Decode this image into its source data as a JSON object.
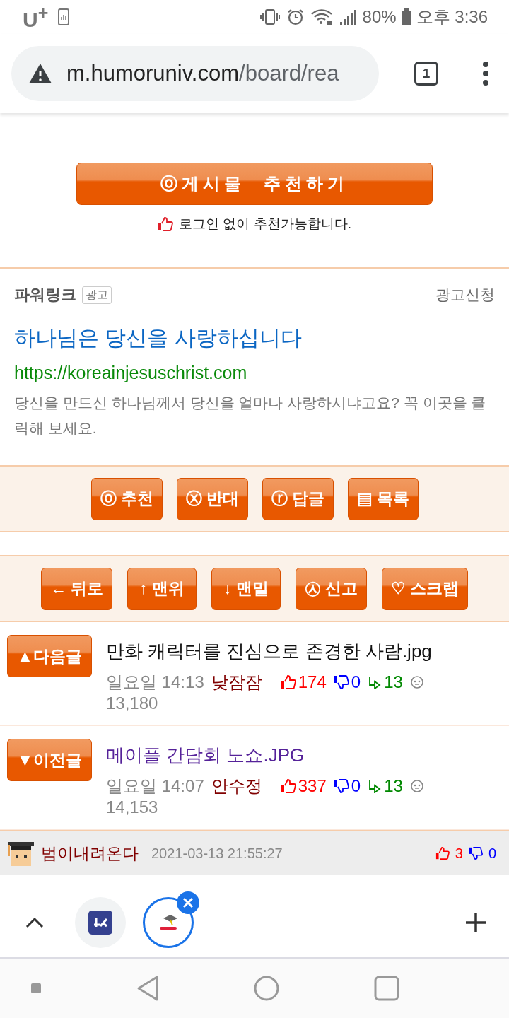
{
  "status_bar": {
    "carrier": "U$^{+}$",
    "battery": "80%",
    "time": "오후 3:36"
  },
  "address_bar": {
    "domain": "m.humoruniv.com",
    "path": "/board/rea",
    "tab_count": "1"
  },
  "recommend": {
    "icon": "ⓞ",
    "label": "게시물  추천하기",
    "note": "로그인 없이 추천가능합니다."
  },
  "ad": {
    "brand": "파워링크",
    "badge": "광고",
    "apply": "광고신청",
    "title": "하나님은 당신을 사랑하십니다",
    "url": "https://koreainjesuschrist.com",
    "description": "당신을 만드신 하나님께서 당신을 얼마나 사랑하시냐고요? 꼭 이곳을 클릭해 보세요."
  },
  "action_buttons": [
    {
      "icon": "ⓞ",
      "label": "추천"
    },
    {
      "icon": "ⓧ",
      "label": "반대"
    },
    {
      "icon": "ⓡ",
      "label": "답글"
    },
    {
      "icon": "▤",
      "label": "목록"
    }
  ],
  "nav_buttons": [
    {
      "icon": "←",
      "label": "뒤로"
    },
    {
      "icon": "↑",
      "label": "맨위"
    },
    {
      "icon": "↓",
      "label": "맨밑"
    },
    {
      "icon": "㉦",
      "label": "신고"
    },
    {
      "icon": "♡",
      "label": "스크랩"
    }
  ],
  "posts": [
    {
      "button": "▲다음글",
      "title": "만화 캐릭터를 진심으로 존경한 사람.jpg",
      "visited": false,
      "day": "일요일 14:13",
      "author": "낮잠잠",
      "up": "174",
      "down": "0",
      "replies": "13",
      "views": "13,180"
    },
    {
      "button": "▼이전글",
      "title": "메이플 간담회 노쇼.JPG",
      "visited": true,
      "day": "일요일 14:07",
      "author": "안수정",
      "up": "337",
      "down": "0",
      "replies": "13",
      "views": "14,153"
    }
  ],
  "comment": {
    "author": "범이내려온다",
    "date": "2021-03-13 21:55:27",
    "up": "3",
    "down": "0"
  },
  "tab_strip": {
    "tabs": [
      {
        "selected": false
      },
      {
        "selected": true
      }
    ]
  }
}
